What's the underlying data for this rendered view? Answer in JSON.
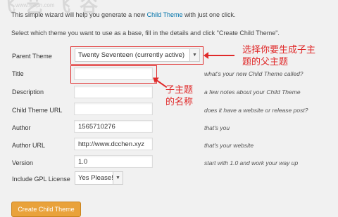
{
  "watermark": {
    "logo_text": "飞 艺 飞 谷",
    "url": "www.wepn.com"
  },
  "intro": {
    "before_link": "This simple wizard will help you generate a new ",
    "link": "Child Theme",
    "after_link": " with just one click."
  },
  "instructions": "Select which theme you want to use as a base, fill in the details and click \"Create Child Theme\".",
  "form": {
    "parent_theme": {
      "label": "Parent Theme",
      "selected": "Twenty Seventeen (currently active)"
    },
    "title": {
      "label": "Title",
      "value": "",
      "hint": "what's your new Child Theme called?"
    },
    "description": {
      "label": "Description",
      "value": "",
      "hint": "a few notes about your Child Theme"
    },
    "child_theme_url": {
      "label": "Child Theme URL",
      "value": "",
      "hint": "does it have a website or release post?"
    },
    "author": {
      "label": "Author",
      "value": "1565710276",
      "hint": "that's you"
    },
    "author_url": {
      "label": "Author URL",
      "value": "http://www.dcchen.xyz",
      "hint": "that's your website"
    },
    "version": {
      "label": "Version",
      "value": "1.0",
      "hint": "start with 1.0 and work your way up"
    },
    "gpl": {
      "label": "Include GPL License",
      "selected": "Yes Please!"
    }
  },
  "annotations": {
    "parent_note": [
      "选择你要生成子主",
      "题的父主题"
    ],
    "title_note": [
      "子主题",
      "的名称"
    ]
  },
  "create_button": "Create Child Theme",
  "colors": {
    "link": "#0073aa",
    "annotation": "#e02a2a",
    "button": "#e9a23b"
  }
}
